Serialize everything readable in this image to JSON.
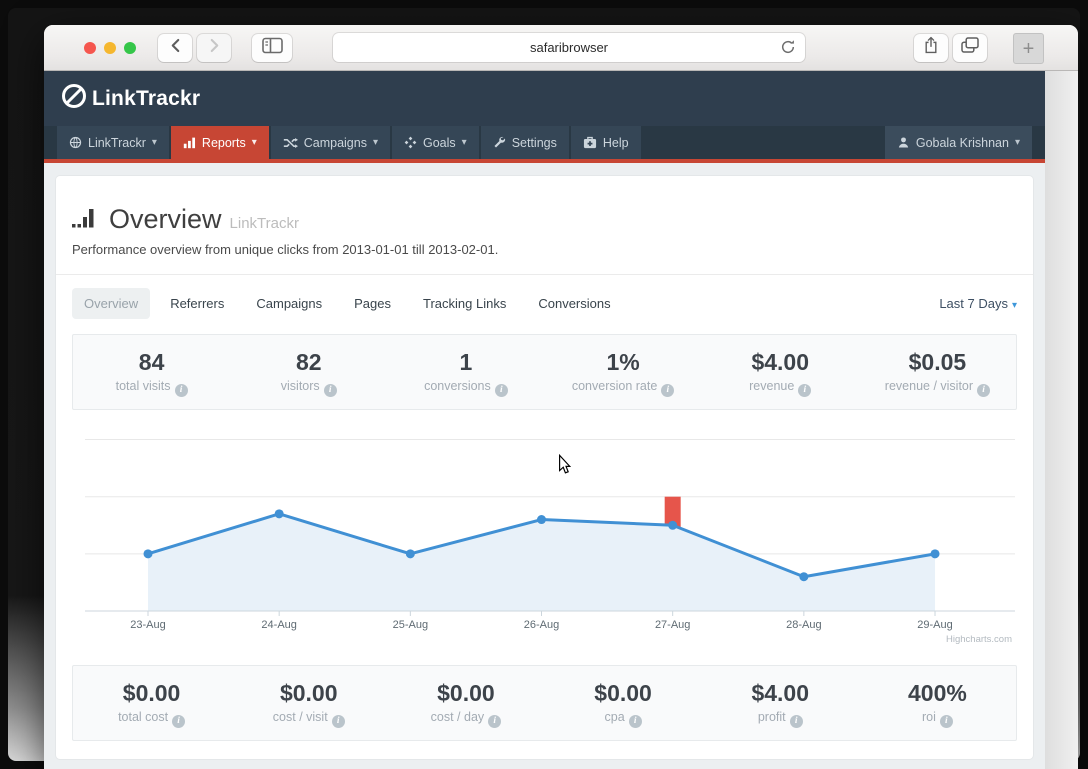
{
  "browser": {
    "url_text": "safaribrowser",
    "new_tab_glyph": "+"
  },
  "brand": {
    "logo_text": "LinkTrackr"
  },
  "navbar": {
    "items": [
      {
        "label": "LinkTrackr",
        "icon": "linktrackr-globe-icon",
        "caret": true,
        "active": false
      },
      {
        "label": "Reports",
        "icon": "bar-chart-icon",
        "caret": true,
        "active": true
      },
      {
        "label": "Campaigns",
        "icon": "shuffle-icon",
        "caret": true,
        "active": false
      },
      {
        "label": "Goals",
        "icon": "goals-diamond-icon",
        "caret": true,
        "active": false
      },
      {
        "label": "Settings",
        "icon": "wrench-icon",
        "caret": false,
        "active": false
      },
      {
        "label": "Help",
        "icon": "medkit-icon",
        "caret": false,
        "active": false
      }
    ],
    "user": {
      "label": "Gobala Krishnan",
      "icon": "user-icon",
      "caret": true
    }
  },
  "page": {
    "title": "Overview",
    "title_suffix": "LinkTrackr",
    "subtitle": "Performance overview from unique clicks from 2013-01-01 till 2013-02-01."
  },
  "tabs": {
    "items": [
      {
        "label": "Overview",
        "active": true
      },
      {
        "label": "Referrers",
        "active": false
      },
      {
        "label": "Campaigns",
        "active": false
      },
      {
        "label": "Pages",
        "active": false
      },
      {
        "label": "Tracking Links",
        "active": false
      },
      {
        "label": "Conversions",
        "active": false
      }
    ],
    "range_selector": "Last 7 Days"
  },
  "stats_top": [
    {
      "value": "84",
      "label": "total visits"
    },
    {
      "value": "82",
      "label": "visitors"
    },
    {
      "value": "1",
      "label": "conversions"
    },
    {
      "value": "1%",
      "label": "conversion rate"
    },
    {
      "value": "$4.00",
      "label": "revenue"
    },
    {
      "value": "$0.05",
      "label": "revenue / visitor"
    }
  ],
  "stats_bottom": [
    {
      "value": "$0.00",
      "label": "total cost"
    },
    {
      "value": "$0.00",
      "label": "cost / visit"
    },
    {
      "value": "$0.00",
      "label": "cost / day"
    },
    {
      "value": "$0.00",
      "label": "cpa"
    },
    {
      "value": "$4.00",
      "label": "profit"
    },
    {
      "value": "400%",
      "label": "roi"
    }
  ],
  "chart_data": {
    "type": "line",
    "title": "",
    "categories": [
      "23-Aug",
      "24-Aug",
      "25-Aug",
      "26-Aug",
      "27-Aug",
      "28-Aug",
      "29-Aug"
    ],
    "series": [
      {
        "name": "unique clicks",
        "values": [
          10,
          17,
          10,
          16,
          15,
          6,
          10
        ],
        "color": "#4090d4",
        "area_fill": "#e8f1f9"
      }
    ],
    "annotation_bar": {
      "category": "27-Aug",
      "from": 0,
      "to": 20,
      "color": "#e6554b"
    },
    "ylim": [
      0,
      34
    ],
    "gridlines": [
      10,
      20,
      30
    ],
    "grid": true,
    "legend": "none",
    "credits": "Highcharts.com"
  },
  "ui": {
    "caret_glyph": "▾",
    "info_glyph": "i"
  }
}
